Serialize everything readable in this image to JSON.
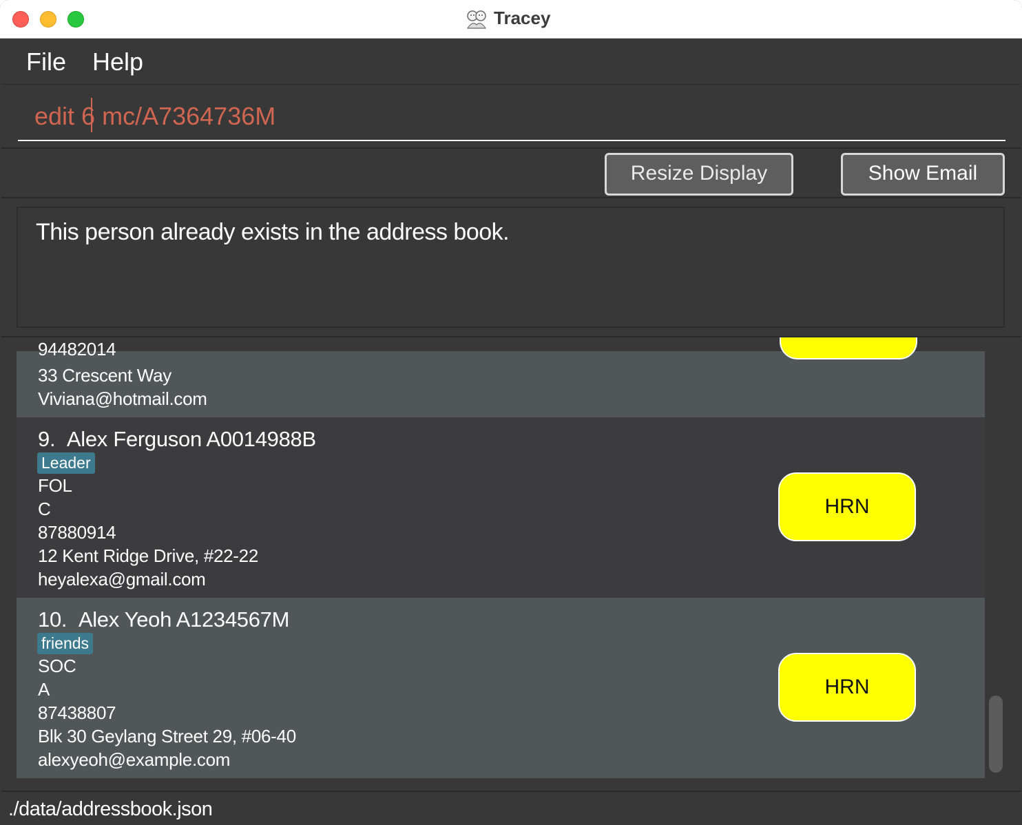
{
  "window": {
    "title": "Tracey",
    "app_icon": "tracey-logo-icon"
  },
  "menu": {
    "file": "File",
    "help": "Help"
  },
  "command": {
    "before_caret": "edit 6",
    "after_caret": "mc/A7364736M"
  },
  "buttons": {
    "resize": "Resize Display",
    "show_email": "Show Email"
  },
  "result": {
    "message": "This person already exists in the address book."
  },
  "persons": [
    {
      "partial_phone": "94482014",
      "address": "33 Crescent Way",
      "email": "Viviana@hotmail.com"
    },
    {
      "index": "9.",
      "name": "Alex Ferguson A0014988B",
      "tag": "Leader",
      "faculty": "FOL",
      "vaccination": "C",
      "phone": "87880914",
      "address": "12 Kent Ridge Drive, #22-22",
      "email": "heyalexa@gmail.com",
      "hall": "HRN"
    },
    {
      "index": "10.",
      "name": "Alex Yeoh A1234567M",
      "tag": "friends",
      "faculty": "SOC",
      "vaccination": "A",
      "phone": "87438807",
      "address": "Blk 30 Geylang Street 29, #06-40",
      "email": "alexyeoh@example.com",
      "hall": "HRN"
    }
  ],
  "status": {
    "file_path": "./data/addressbook.json"
  },
  "colors": {
    "pill": "#ffff00",
    "tag": "#3d7a8e",
    "command_text": "#d06651",
    "card_light": "#515658",
    "card_dark": "#3c3c3e"
  }
}
